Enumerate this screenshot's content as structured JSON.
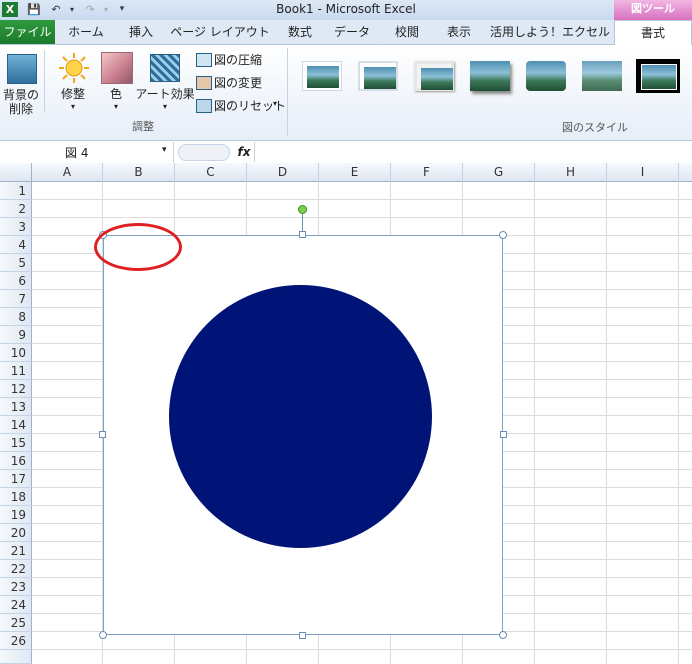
{
  "window": {
    "title": "Book1  -  Microsoft Excel",
    "tools_banner": "図ツール"
  },
  "tabs": {
    "file": "ファイル",
    "items": [
      "ホーム",
      "挿入",
      "ページ レイアウト",
      "数式",
      "データ",
      "校閲",
      "表示",
      "活用しよう！エクセル"
    ],
    "active": "書式"
  },
  "ribbon": {
    "remove_bg": [
      "背景の",
      "削除"
    ],
    "corrections": "修整",
    "color": "色",
    "artistic": "アート効果",
    "compress": "図の圧縮",
    "change": "図の変更",
    "reset": "図のリセット",
    "adjust_group": "調整",
    "styles_group": "図のスタイル"
  },
  "formula_bar": {
    "name_box": "図 4",
    "fx": "fx",
    "formula": ""
  },
  "grid": {
    "columns": [
      "A",
      "B",
      "C",
      "D",
      "E",
      "F",
      "G",
      "H",
      "I"
    ],
    "rows": [
      "1",
      "2",
      "3",
      "4",
      "5",
      "6",
      "7",
      "8",
      "9",
      "10",
      "11",
      "12",
      "13",
      "14",
      "15",
      "16",
      "17",
      "18",
      "19",
      "20",
      "21",
      "22",
      "23",
      "24",
      "25",
      "26"
    ]
  },
  "colors": {
    "circle": "#001477",
    "annotation": "#e02020",
    "file_tab": "#1f7f2c",
    "tools_banner": "#d870c0"
  }
}
